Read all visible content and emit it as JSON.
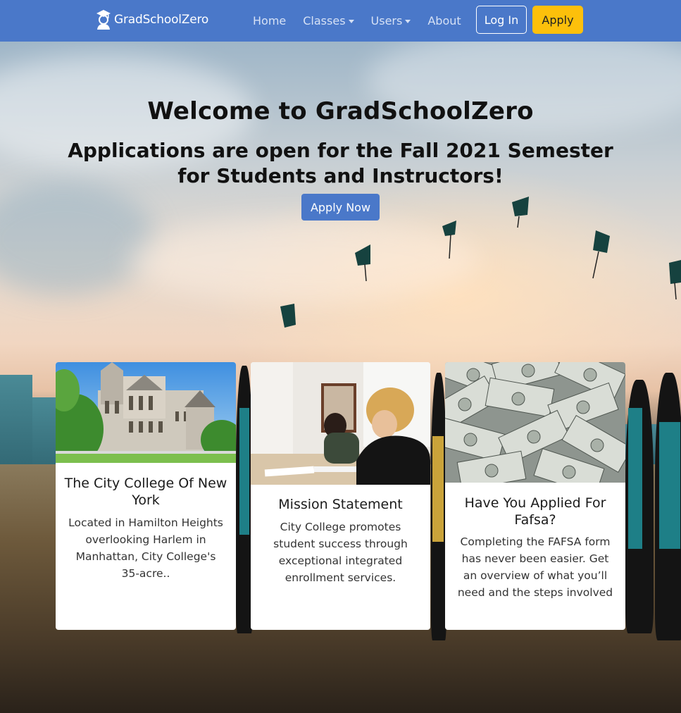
{
  "navbar": {
    "brand": "GradSchoolZero",
    "links": [
      {
        "label": "Home",
        "dropdown": false
      },
      {
        "label": "Classes",
        "dropdown": true
      },
      {
        "label": "Users",
        "dropdown": true
      },
      {
        "label": "About",
        "dropdown": false
      }
    ],
    "login_label": "Log In",
    "apply_label": "Apply",
    "colors": {
      "bar": "#4a78c9",
      "apply_button": "#fdc00b"
    }
  },
  "hero": {
    "title": "Welcome to GradSchoolZero",
    "subtitle": "Applications are open for the Fall 2021 Semester for Students and Instructors!",
    "cta_label": "Apply Now"
  },
  "cards": [
    {
      "title": "The City College Of New York",
      "text": "Located in Hamilton Heights overlooking Harlem in Manhattan, City College's 35-acre..",
      "image": "gothic-campus-building-photo"
    },
    {
      "title": "Mission Statement",
      "text": "City College promotes student success through exceptional integrated enrollment services.",
      "image": "students-studying-photo"
    },
    {
      "title": "Have You Applied For Fafsa?",
      "text": "Completing the FAFSA form has never been easier. Get an overview of what you’ll need and the steps involved",
      "image": "dollar-bills-photo"
    }
  ]
}
